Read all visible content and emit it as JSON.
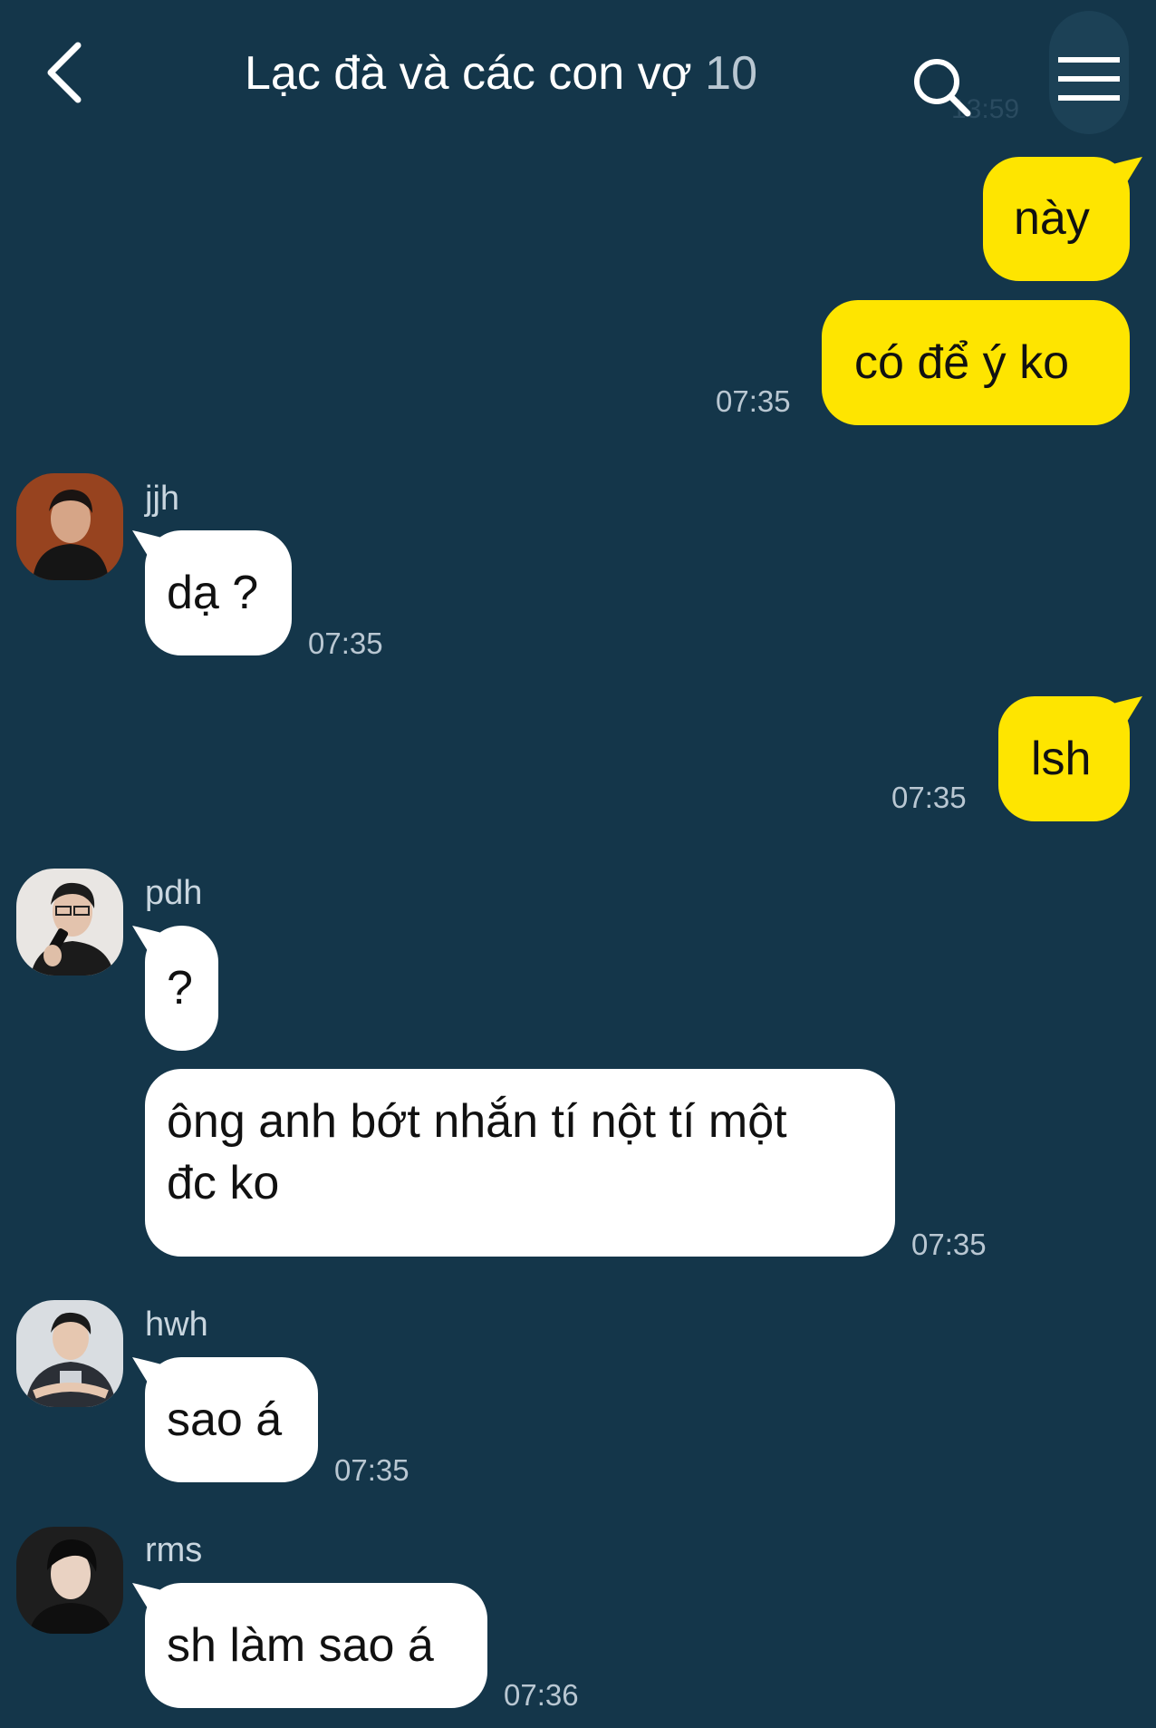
{
  "header": {
    "title": "Lạc đà và các con vợ",
    "member_count": "10",
    "ghost_time": "13:59"
  },
  "colors": {
    "background": "#14364a",
    "my_bubble": "#fee500",
    "their_bubble": "#ffffff",
    "timestamp": "#b9c7d2"
  },
  "messages": {
    "m1": {
      "text": "này"
    },
    "m2": {
      "text": "có để ý ko",
      "time": "07:35"
    },
    "m3": {
      "sender": "jjh",
      "text": "dạ ?",
      "time": "07:35"
    },
    "m4": {
      "text": "lsh",
      "time": "07:35"
    },
    "m5": {
      "sender": "pdh",
      "text": "?"
    },
    "m6": {
      "line1": "ông anh bớt nhắn tí nột tí một",
      "line2": "đc ko",
      "time": "07:35"
    },
    "m7": {
      "sender": "hwh",
      "text": "sao á",
      "time": "07:35"
    },
    "m8": {
      "sender": "rms",
      "text": "sh làm sao á",
      "time": "07:36"
    }
  }
}
